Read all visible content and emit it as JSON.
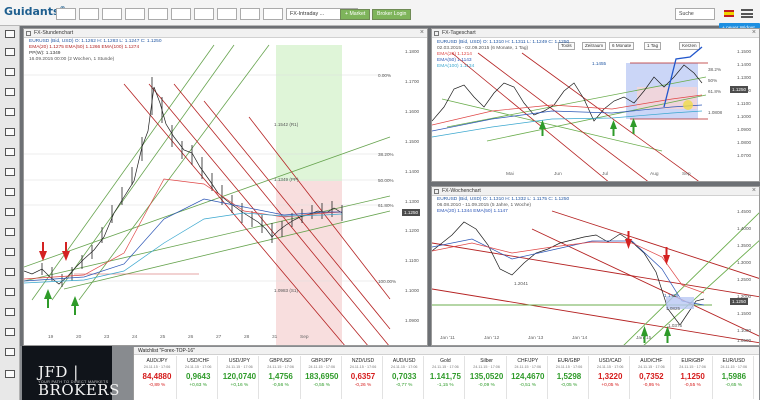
{
  "app": {
    "brand": "Guidants",
    "tabs": [
      "",
      "",
      "",
      "",
      "",
      "",
      "",
      "",
      "",
      "",
      "FX-Intraday ..."
    ],
    "toolbar": {
      "market": "+ Market",
      "broker_login": "Broker Login",
      "search": "Suche",
      "new_chart": "+ neuer Widget"
    }
  },
  "left_chart": {
    "title": "FX-Stundenchart",
    "legend": [
      "EURUSD (Bid, USD)  O: 1.1262  H: 1.1283  L: 1.1247  C: 1.1250",
      "EMA(20) 1.1275   EMA(50) 1.1266   EMA(100) 1.1274",
      "PP(W): 1.1349",
      "16.09.2015 00:00 (2 Wochen, 1 Stunde)"
    ],
    "levels": [
      "0.00%",
      "38.20%",
      "50.00%",
      "61.80%",
      "100.00%"
    ],
    "pp_labels": [
      "1.1542 (R1)",
      "1.1349 (PP)",
      "1.0983 (S1)"
    ],
    "price_ticks": [
      "1.1800",
      "1.1700",
      "1.1600",
      "1.1500",
      "1.1400",
      "1.1300",
      "1.1200",
      "1.1100",
      "1.1000",
      "1.0900"
    ],
    "current_price": "1.1250",
    "x_ticks": [
      "19",
      "20",
      "23",
      "24",
      "25",
      "26",
      "27",
      "28",
      "31",
      "Sep"
    ]
  },
  "top_right_chart": {
    "title": "FX-Tageschart",
    "legend": [
      "EURUSD (Bid, USD)  O: 1.1310  H: 1.1311  L: 1.1249  C: 1.1250",
      "02.03.2015 - 02.09.2015 (6 Monate, 1 Tag)",
      "EMA(20) 1.1214",
      "EMA(50) 1.1143",
      "EMA(100) 1.1134"
    ],
    "tools": [
      "Tools",
      "Zeitraum",
      "6 Monate",
      "1 Tag",
      "Kerzen"
    ],
    "price_ticks": [
      "1.1500",
      "1.1400",
      "1.1300",
      "1.1200",
      "1.1100",
      "1.1000",
      "1.0900",
      "1.0800",
      "1.0700"
    ],
    "x_ticks": [
      "Mai",
      "Jun",
      "Jul",
      "Aug",
      "Sep"
    ],
    "current_price": "1.1250",
    "level_labels": [
      "1.1455",
      "38.2%",
      "50%",
      "61.8%",
      "1.0808"
    ]
  },
  "bottom_right_chart": {
    "title": "FX-Wochenchart",
    "legend": [
      "EURUSD (Bid, USD)  O: 1.1310  H: 1.1332  L: 1.1175  C: 1.1250",
      "06.08.2010 - 11.09.2015 (5 Jahre, 1 Woche)",
      "EMA(20) 1.1344   EMA(50) 1.1147"
    ],
    "price_ticks": [
      "1.4500",
      "1.4000",
      "1.3500",
      "1.3000",
      "1.2500",
      "1.2000",
      "1.1500",
      "1.1000",
      "1.0500"
    ],
    "x_ticks": [
      "Jan '11",
      "Jan '12",
      "Jan '13",
      "Jan '14",
      "Jan '15"
    ],
    "current_price": "1.1250",
    "labels": [
      "1.2041",
      "1.1435",
      "1.0825",
      "1.0375"
    ]
  },
  "watchlist": {
    "title": "Watchlist \"Forex-TOP-16\"",
    "broker": "JFD | BROKERS",
    "broker_sub": "YOUR PATH TO DIRECT MARKETS",
    "items": [
      {
        "name": "AUD/JPY",
        "sub": "24.11.15 · 17:06",
        "value": "84,4880",
        "change": "-0,89 %",
        "color": "#d51b1b"
      },
      {
        "name": "USD/CHF",
        "sub": "24.11.15 · 17:06",
        "value": "0,9643",
        "change": "+0,63 %",
        "color": "#2f9b2a"
      },
      {
        "name": "USD/JPY",
        "sub": "24.11.15 · 17:06",
        "value": "120,0740",
        "change": "+0,16 %",
        "color": "#2f9b2a"
      },
      {
        "name": "GBP/USD",
        "sub": "24.11.15 · 17:06",
        "value": "1,4756",
        "change": "-0,56 %",
        "color": "#2f9b2a"
      },
      {
        "name": "GBP/JPY",
        "sub": "24.11.15 · 17:06",
        "value": "183,6950",
        "change": "-0,55 %",
        "color": "#2f9b2a"
      },
      {
        "name": "NZD/USD",
        "sub": "24.11.15 · 17:06",
        "value": "0,6357",
        "change": "-0,26 %",
        "color": "#d51b1b"
      },
      {
        "name": "AUD/USD",
        "sub": "24.11.15 · 17:06",
        "value": "0,7033",
        "change": "-0,77 %",
        "color": "#2f9b2a"
      },
      {
        "name": "Gold",
        "sub": "24.11.15 · 17:06",
        "value": "1.141,75",
        "change": "-1,15 %",
        "color": "#2f9b2a"
      },
      {
        "name": "Silber",
        "sub": "24.11.15 · 17:06",
        "value": "135,0520",
        "change": "-0,09 %",
        "color": "#2f9b2a"
      },
      {
        "name": "CHF/JPY",
        "sub": "24.11.15 · 17:06",
        "value": "124,4670",
        "change": "-0,51 %",
        "color": "#2f9b2a"
      },
      {
        "name": "EUR/GBP",
        "sub": "24.11.15 · 17:06",
        "value": "1,5298",
        "change": "-0,05 %",
        "color": "#2f9b2a"
      },
      {
        "name": "USD/CAD",
        "sub": "24.11.15 · 17:06",
        "value": "1,3220",
        "change": "+0,05 %",
        "color": "#d51b1b"
      },
      {
        "name": "AUD/CHF",
        "sub": "24.11.15 · 17:06",
        "value": "0,7352",
        "change": "-0,95 %",
        "color": "#d51b1b"
      },
      {
        "name": "EUR/GBP",
        "sub": "24.11.15 · 17:06",
        "value": "1,1250",
        "change": "-0,55 %",
        "color": "#d51b1b"
      },
      {
        "name": "EUR/USD",
        "sub": "24.11.15 · 17:06",
        "value": "1,5986",
        "change": "-0,65 %",
        "color": "#2f9b2a"
      }
    ]
  }
}
